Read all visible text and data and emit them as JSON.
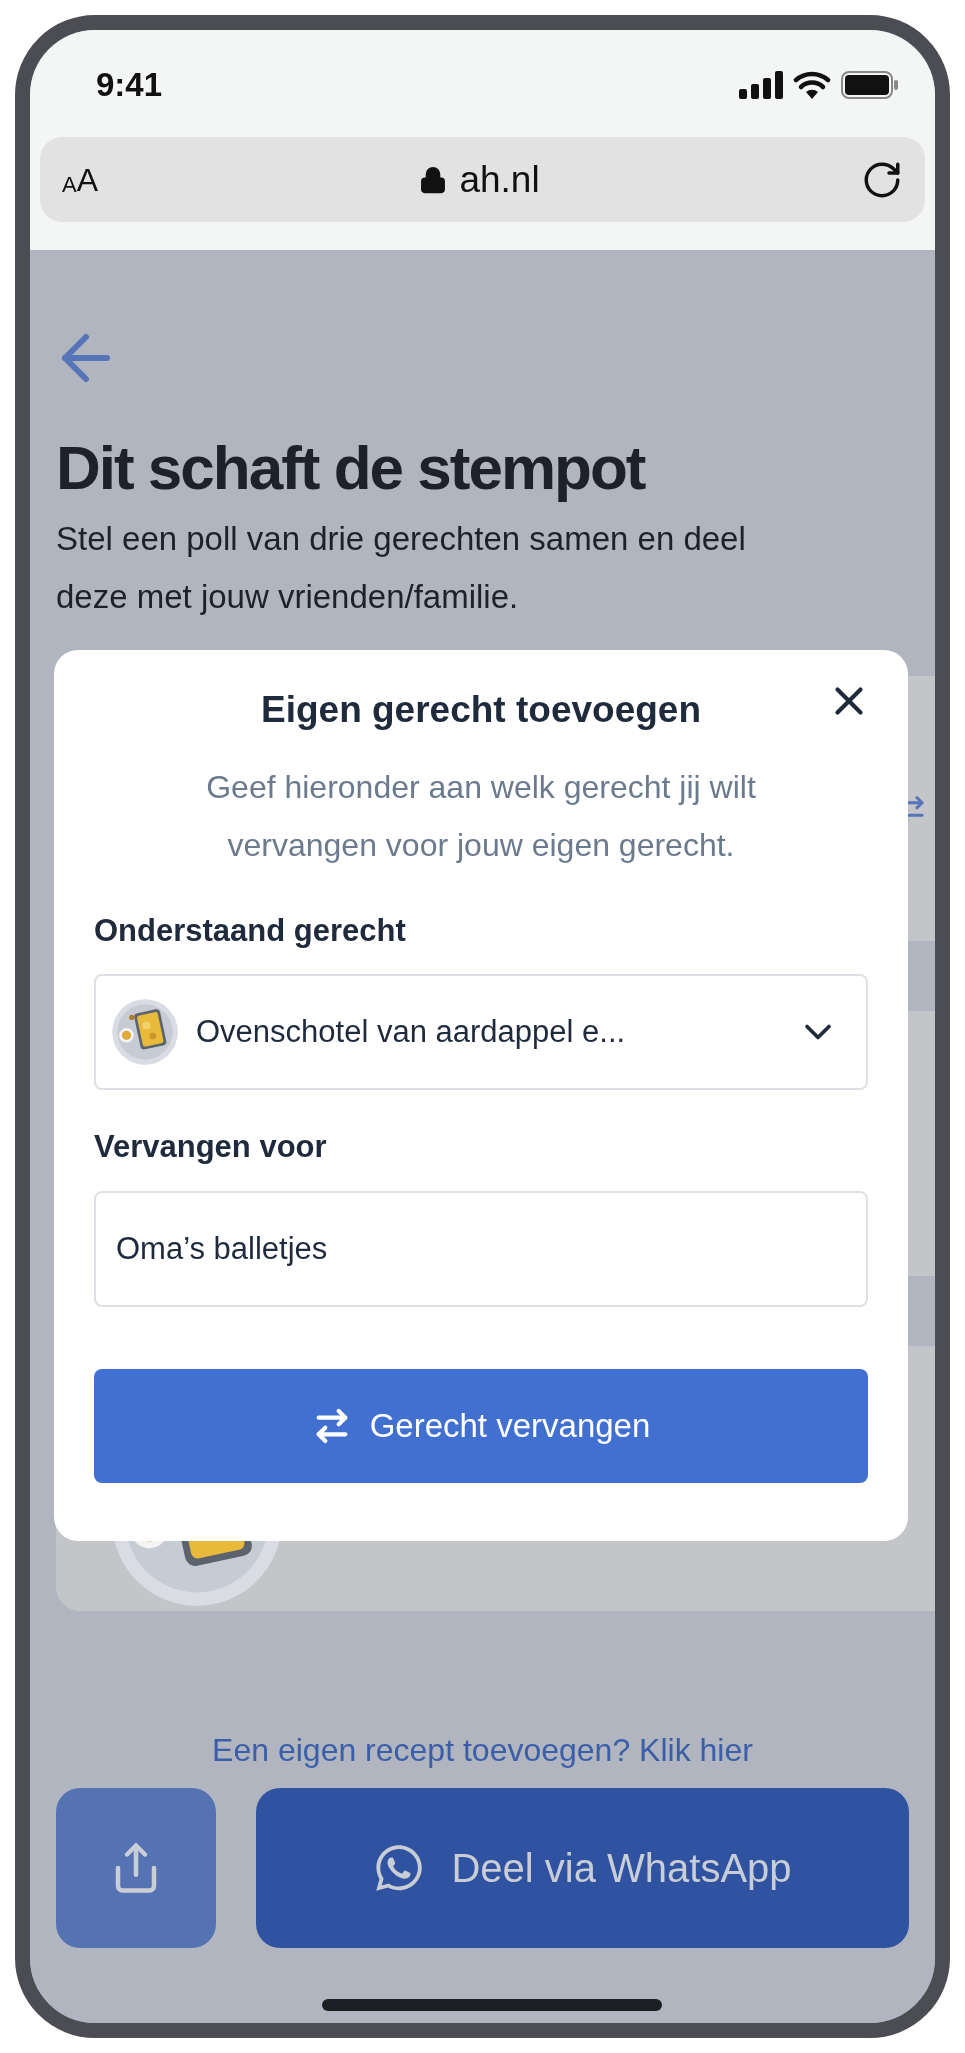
{
  "status_bar": {
    "time": "9:41"
  },
  "browser": {
    "text_size": {
      "small": "A",
      "large": "A"
    },
    "url": "ah.nl"
  },
  "page": {
    "title": "Dit schaft de stempot",
    "subtitle": "Stel een poll van drie gerechten samen en deel deze met jouw vrienden/familie.",
    "link": "Een eigen recept toevoegen? Klik hier",
    "whatsapp_button": "Deel via WhatsApp"
  },
  "modal": {
    "title": "Eigen gerecht toevoegen",
    "description": "Geef hieronder aan welk gerecht jij wilt vervangen voor jouw eigen gerecht.",
    "fields": [
      {
        "kind": "select",
        "label": "Onderstaand gerecht",
        "value": "Ovenschotel van aardappel e..."
      },
      {
        "kind": "text",
        "label": "Vervangen voor",
        "value": "Oma’s balletjes"
      }
    ],
    "button": "Gerecht vervangen"
  }
}
